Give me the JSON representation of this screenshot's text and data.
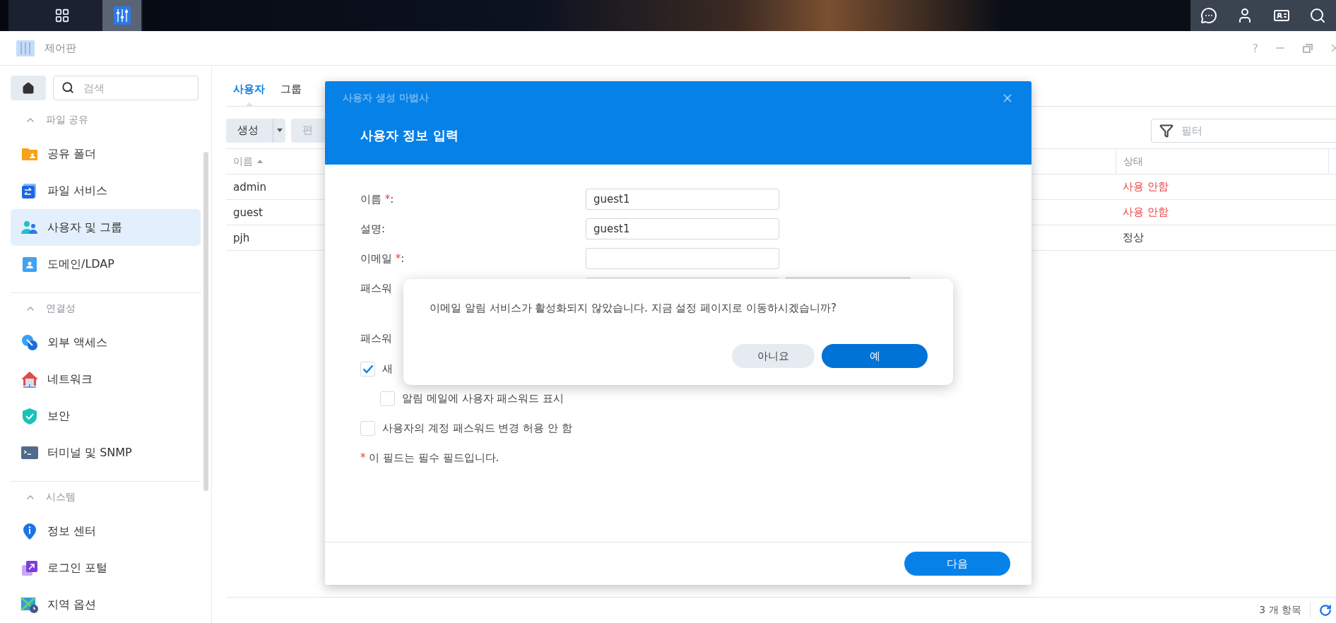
{
  "window": {
    "title": "제어판",
    "help": "?"
  },
  "sidebar": {
    "search": {
      "placeholder": "검색"
    },
    "sections": [
      {
        "title": "파일 공유",
        "expanded": true,
        "items": [
          {
            "label": "공유 폴더",
            "selected": false
          },
          {
            "label": "파일 서비스",
            "selected": false
          },
          {
            "label": "사용자 및 그룹",
            "selected": true
          },
          {
            "label": "도메인/LDAP",
            "selected": false
          }
        ]
      },
      {
        "title": "연결성",
        "expanded": true,
        "items": [
          {
            "label": "외부 액세스",
            "selected": false
          },
          {
            "label": "네트워크",
            "selected": false
          },
          {
            "label": "보안",
            "selected": false
          },
          {
            "label": "터미널 및 SNMP",
            "selected": false
          }
        ]
      },
      {
        "title": "시스템",
        "expanded": true,
        "items": [
          {
            "label": "정보 센터",
            "selected": false
          },
          {
            "label": "로그인 포털",
            "selected": false
          },
          {
            "label": "지역 옵션",
            "selected": false
          }
        ]
      }
    ]
  },
  "tabs": [
    {
      "label": "사용자",
      "selected": true
    },
    {
      "label": "그룹",
      "selected": false
    }
  ],
  "toolbar": {
    "buttons": [
      {
        "label": "생성",
        "disabled": false
      },
      {
        "label": "편",
        "disabled": true
      }
    ],
    "filter": {
      "placeholder": "필터"
    }
  },
  "table": {
    "columns": [
      "이름",
      "상태"
    ],
    "rows": [
      {
        "name": "admin",
        "status": "사용 안함",
        "disabled": true
      },
      {
        "name": "guest",
        "status": "사용 안함",
        "disabled": true
      },
      {
        "name": "pjh",
        "status": "정상",
        "disabled": false
      }
    ]
  },
  "footer": {
    "count": "3 개 항목"
  },
  "wizard": {
    "title": "사용자 생성 마법사",
    "heading": "사용자 정보 입력",
    "fields": [
      {
        "label": "이름 ",
        "required": "*",
        "suffix": ":",
        "value": "guest1"
      },
      {
        "label": "설명:",
        "value": "guest1"
      },
      {
        "label": "이메일 ",
        "required": "*",
        "suffix": ":"
      },
      {
        "label": "패스워"
      }
    ],
    "section_label": "패스워",
    "checkboxes": [
      {
        "label": "새",
        "checked": true,
        "indent": false
      },
      {
        "label": "알림 메일에 사용자 패스워드 표시",
        "checked": false,
        "indent": true
      },
      {
        "label": "사용자의 계정 패스워드 변경 허용 안 함",
        "checked": false,
        "indent": false
      }
    ],
    "note": {
      "mark": "*",
      "text": "이 필드는 필수 필드입니다."
    },
    "next_button": "다음"
  },
  "alert": {
    "message": "이메일 알림 서비스가 활성화되지 않았습니다. 지금 설정 페이지로 이동하시겠습니까?",
    "buttons": [
      {
        "label": "아니요",
        "primary": false
      },
      {
        "label": "예",
        "primary": true
      }
    ]
  }
}
